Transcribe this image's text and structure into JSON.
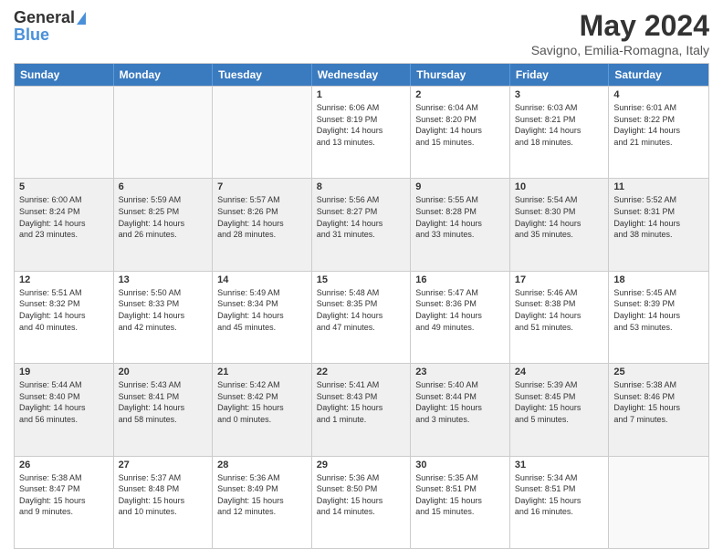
{
  "header": {
    "logo_line1": "General",
    "logo_line2": "Blue",
    "main_title": "May 2024",
    "subtitle": "Savigno, Emilia-Romagna, Italy"
  },
  "calendar": {
    "days": [
      "Sunday",
      "Monday",
      "Tuesday",
      "Wednesday",
      "Thursday",
      "Friday",
      "Saturday"
    ],
    "rows": [
      [
        {
          "day": "",
          "empty": true
        },
        {
          "day": "",
          "empty": true
        },
        {
          "day": "",
          "empty": true
        },
        {
          "day": "1",
          "lines": [
            "Sunrise: 6:06 AM",
            "Sunset: 8:19 PM",
            "Daylight: 14 hours",
            "and 13 minutes."
          ]
        },
        {
          "day": "2",
          "lines": [
            "Sunrise: 6:04 AM",
            "Sunset: 8:20 PM",
            "Daylight: 14 hours",
            "and 15 minutes."
          ]
        },
        {
          "day": "3",
          "lines": [
            "Sunrise: 6:03 AM",
            "Sunset: 8:21 PM",
            "Daylight: 14 hours",
            "and 18 minutes."
          ]
        },
        {
          "day": "4",
          "lines": [
            "Sunrise: 6:01 AM",
            "Sunset: 8:22 PM",
            "Daylight: 14 hours",
            "and 21 minutes."
          ]
        }
      ],
      [
        {
          "day": "5",
          "lines": [
            "Sunrise: 6:00 AM",
            "Sunset: 8:24 PM",
            "Daylight: 14 hours",
            "and 23 minutes."
          ]
        },
        {
          "day": "6",
          "lines": [
            "Sunrise: 5:59 AM",
            "Sunset: 8:25 PM",
            "Daylight: 14 hours",
            "and 26 minutes."
          ]
        },
        {
          "day": "7",
          "lines": [
            "Sunrise: 5:57 AM",
            "Sunset: 8:26 PM",
            "Daylight: 14 hours",
            "and 28 minutes."
          ]
        },
        {
          "day": "8",
          "lines": [
            "Sunrise: 5:56 AM",
            "Sunset: 8:27 PM",
            "Daylight: 14 hours",
            "and 31 minutes."
          ]
        },
        {
          "day": "9",
          "lines": [
            "Sunrise: 5:55 AM",
            "Sunset: 8:28 PM",
            "Daylight: 14 hours",
            "and 33 minutes."
          ]
        },
        {
          "day": "10",
          "lines": [
            "Sunrise: 5:54 AM",
            "Sunset: 8:30 PM",
            "Daylight: 14 hours",
            "and 35 minutes."
          ]
        },
        {
          "day": "11",
          "lines": [
            "Sunrise: 5:52 AM",
            "Sunset: 8:31 PM",
            "Daylight: 14 hours",
            "and 38 minutes."
          ]
        }
      ],
      [
        {
          "day": "12",
          "lines": [
            "Sunrise: 5:51 AM",
            "Sunset: 8:32 PM",
            "Daylight: 14 hours",
            "and 40 minutes."
          ]
        },
        {
          "day": "13",
          "lines": [
            "Sunrise: 5:50 AM",
            "Sunset: 8:33 PM",
            "Daylight: 14 hours",
            "and 42 minutes."
          ]
        },
        {
          "day": "14",
          "lines": [
            "Sunrise: 5:49 AM",
            "Sunset: 8:34 PM",
            "Daylight: 14 hours",
            "and 45 minutes."
          ]
        },
        {
          "day": "15",
          "lines": [
            "Sunrise: 5:48 AM",
            "Sunset: 8:35 PM",
            "Daylight: 14 hours",
            "and 47 minutes."
          ]
        },
        {
          "day": "16",
          "lines": [
            "Sunrise: 5:47 AM",
            "Sunset: 8:36 PM",
            "Daylight: 14 hours",
            "and 49 minutes."
          ]
        },
        {
          "day": "17",
          "lines": [
            "Sunrise: 5:46 AM",
            "Sunset: 8:38 PM",
            "Daylight: 14 hours",
            "and 51 minutes."
          ]
        },
        {
          "day": "18",
          "lines": [
            "Sunrise: 5:45 AM",
            "Sunset: 8:39 PM",
            "Daylight: 14 hours",
            "and 53 minutes."
          ]
        }
      ],
      [
        {
          "day": "19",
          "lines": [
            "Sunrise: 5:44 AM",
            "Sunset: 8:40 PM",
            "Daylight: 14 hours",
            "and 56 minutes."
          ]
        },
        {
          "day": "20",
          "lines": [
            "Sunrise: 5:43 AM",
            "Sunset: 8:41 PM",
            "Daylight: 14 hours",
            "and 58 minutes."
          ]
        },
        {
          "day": "21",
          "lines": [
            "Sunrise: 5:42 AM",
            "Sunset: 8:42 PM",
            "Daylight: 15 hours",
            "and 0 minutes."
          ]
        },
        {
          "day": "22",
          "lines": [
            "Sunrise: 5:41 AM",
            "Sunset: 8:43 PM",
            "Daylight: 15 hours",
            "and 1 minute."
          ]
        },
        {
          "day": "23",
          "lines": [
            "Sunrise: 5:40 AM",
            "Sunset: 8:44 PM",
            "Daylight: 15 hours",
            "and 3 minutes."
          ]
        },
        {
          "day": "24",
          "lines": [
            "Sunrise: 5:39 AM",
            "Sunset: 8:45 PM",
            "Daylight: 15 hours",
            "and 5 minutes."
          ]
        },
        {
          "day": "25",
          "lines": [
            "Sunrise: 5:38 AM",
            "Sunset: 8:46 PM",
            "Daylight: 15 hours",
            "and 7 minutes."
          ]
        }
      ],
      [
        {
          "day": "26",
          "lines": [
            "Sunrise: 5:38 AM",
            "Sunset: 8:47 PM",
            "Daylight: 15 hours",
            "and 9 minutes."
          ]
        },
        {
          "day": "27",
          "lines": [
            "Sunrise: 5:37 AM",
            "Sunset: 8:48 PM",
            "Daylight: 15 hours",
            "and 10 minutes."
          ]
        },
        {
          "day": "28",
          "lines": [
            "Sunrise: 5:36 AM",
            "Sunset: 8:49 PM",
            "Daylight: 15 hours",
            "and 12 minutes."
          ]
        },
        {
          "day": "29",
          "lines": [
            "Sunrise: 5:36 AM",
            "Sunset: 8:50 PM",
            "Daylight: 15 hours",
            "and 14 minutes."
          ]
        },
        {
          "day": "30",
          "lines": [
            "Sunrise: 5:35 AM",
            "Sunset: 8:51 PM",
            "Daylight: 15 hours",
            "and 15 minutes."
          ]
        },
        {
          "day": "31",
          "lines": [
            "Sunrise: 5:34 AM",
            "Sunset: 8:51 PM",
            "Daylight: 15 hours",
            "and 16 minutes."
          ]
        },
        {
          "day": "",
          "empty": true
        }
      ]
    ]
  }
}
